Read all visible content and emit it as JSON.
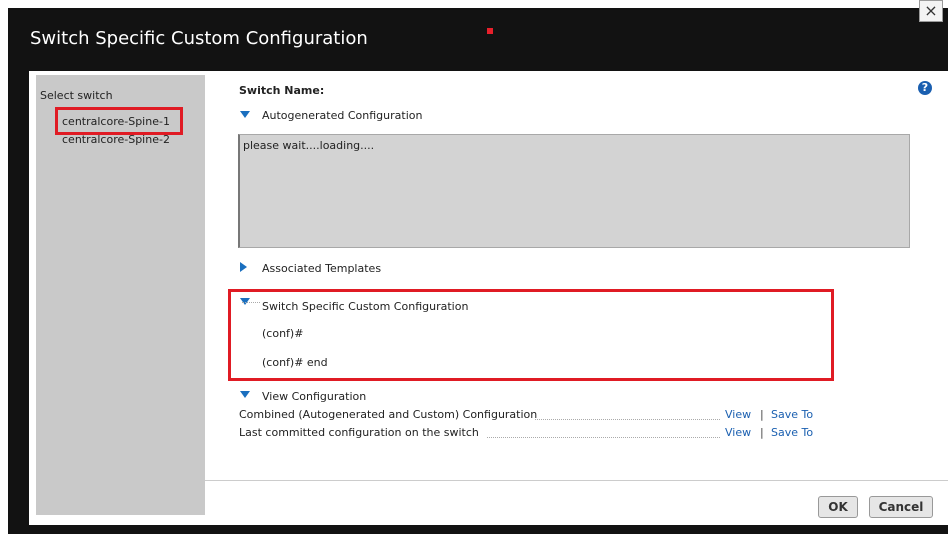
{
  "dialog": {
    "title": "Switch Specific Custom Configuration",
    "close_label": "×"
  },
  "sidebar": {
    "title": "Select switch",
    "switches": [
      "centralcore-Spine-1",
      "centralcore-Spine-2"
    ]
  },
  "main": {
    "switch_name_label": "Switch Name:",
    "autogenerated_label": "Autogenerated Configuration",
    "autogenerated_text": "please wait....loading....",
    "associated_label": "Associated Templates",
    "custom_label": "Switch Specific Custom Configuration",
    "custom_line1": "(conf)#",
    "custom_line2": "(conf)# end",
    "view_config_label": "View Configuration",
    "rows": [
      {
        "label": "Combined (Autogenerated and Custom) Configuration",
        "view": "View",
        "sep": "|",
        "save": "Save To"
      },
      {
        "label": "Last committed configuration on the switch",
        "view": "View",
        "sep": "|",
        "save": "Save To"
      }
    ],
    "help_label": "?"
  },
  "footer": {
    "ok_label": "OK",
    "cancel_label": "Cancel"
  },
  "colors": {
    "accent": "#1a6fbf",
    "highlight_box": "#e01b24",
    "dialog_bg": "#121212"
  }
}
